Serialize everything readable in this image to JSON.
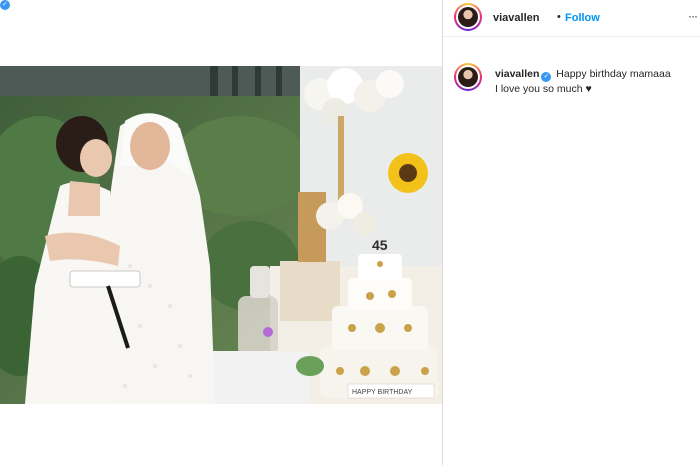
{
  "post": {
    "username": "viavallen",
    "follow_label": "Follow",
    "separator": "•",
    "more_label": "···",
    "verified_glyph": "✓"
  },
  "caption": {
    "username": "viavallen",
    "line1": "Happy birthday mamaaa",
    "line2": "I love you so much ♥"
  },
  "photo": {
    "cake_banner_text": "HAPPY BIRTHDAY",
    "cake_topper_text": "45"
  },
  "colors": {
    "follow_blue": "#0095f6",
    "verified_blue": "#3897f0",
    "divider": "#dbdbdb"
  },
  "icons": [
    "verified-badge-icon",
    "more-options-icon"
  ]
}
